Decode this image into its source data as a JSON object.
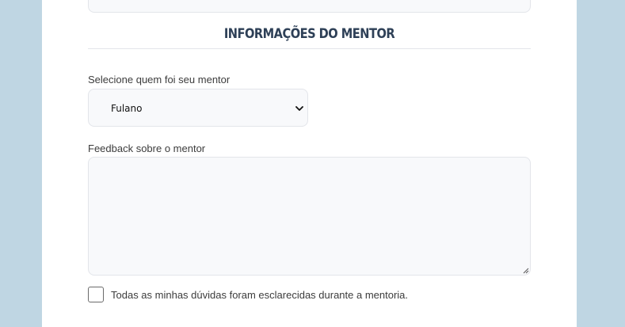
{
  "section": {
    "title": "INFORMAÇÕES DO MENTOR"
  },
  "mentor_select": {
    "label": "Selecione quem foi seu mentor",
    "selected_value": "Fulano"
  },
  "feedback": {
    "label": "Feedback sobre o mentor",
    "value": ""
  },
  "confirmation": {
    "label": "Todas as minhas dúvidas foram esclarecidas durante a mentoria.",
    "checked": false
  },
  "colors": {
    "page_background": "#bfd6e3",
    "panel_background": "#ffffff",
    "title_color": "#2e4057",
    "field_background": "#f8f9fb",
    "field_border": "#e3e5ea"
  }
}
